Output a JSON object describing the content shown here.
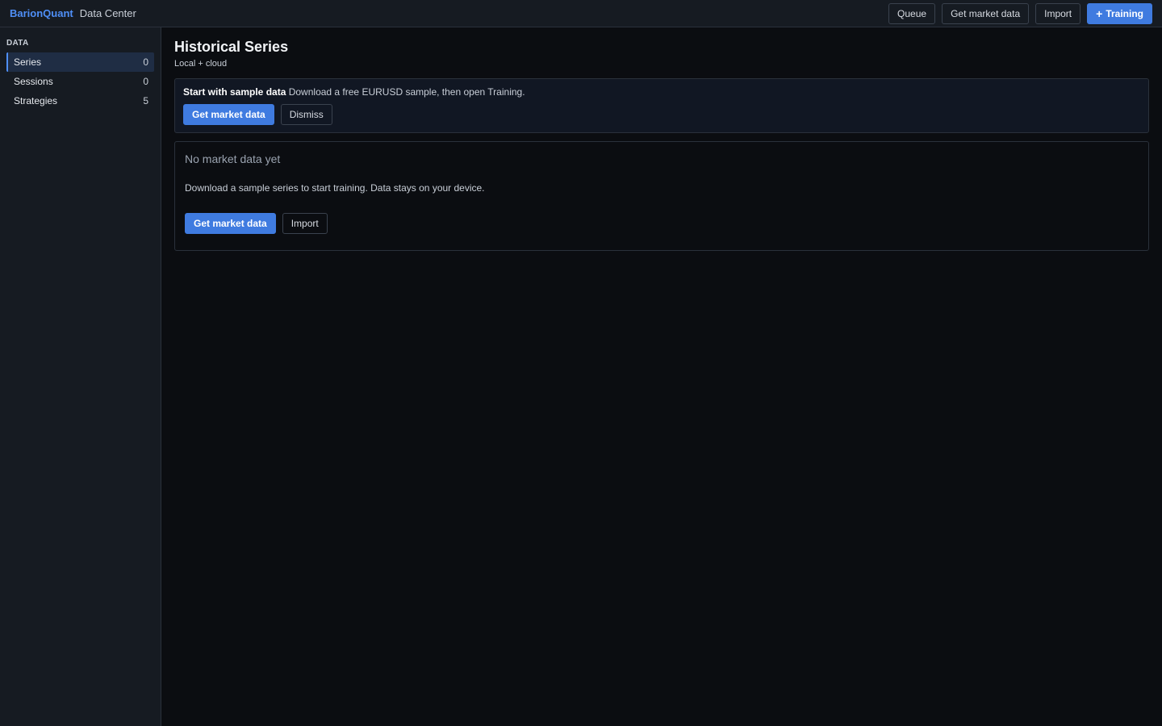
{
  "app": {
    "brand": "BarionQuant",
    "section": "Data Center"
  },
  "toolbar": {
    "queue_label": "Queue",
    "get_market_data_label": "Get market data",
    "import_label": "Import",
    "training_label": "Training",
    "training_icon": "plus-icon"
  },
  "sidebar": {
    "section_title": "DATA",
    "items": [
      {
        "label": "Series",
        "count": "0",
        "active": true
      },
      {
        "label": "Sessions",
        "count": "0",
        "active": false
      },
      {
        "label": "Strategies",
        "count": "5",
        "active": false
      }
    ]
  },
  "main": {
    "title": "Historical Series",
    "subtitle": "Local + cloud",
    "banner": {
      "strong": "Start with sample data",
      "text": "Download a free EURUSD sample, then open Training.",
      "primary_label": "Get market data",
      "dismiss_label": "Dismiss"
    },
    "empty": {
      "title": "No market data yet",
      "description": "Download a sample series to start training. Data stays on your device.",
      "primary_label": "Get market data",
      "import_label": "Import"
    }
  },
  "colors": {
    "accent": "#3f7be0",
    "brand": "#4f8ff7",
    "background": "#0b0d11",
    "panel": "#161b22"
  }
}
